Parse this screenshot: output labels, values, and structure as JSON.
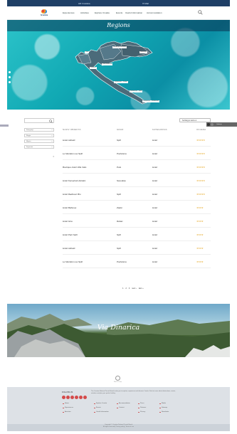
{
  "topbar": {
    "left_text": "HR   hrvatska",
    "right_text": "✉   Mail"
  },
  "logo": {
    "text": "hrvatska"
  },
  "nav": [
    "Experiences",
    "Activities",
    "Explore Croatia",
    "Events",
    "Useful information",
    "Accommodation"
  ],
  "hero": {
    "title": "Regions",
    "map_labels": [
      "Istra",
      "Središnja Hrvatska",
      "Lika-Karlovac",
      "Slavonija",
      "Kvarner",
      "Dalmacija – Zadar",
      "Dalmacija – Split",
      "Dalmacija – Dubrovnik"
    ],
    "colors": {
      "teal": "#11a9b4",
      "land": "#4b6b7a"
    }
  },
  "side_right": {
    "label": "Galerija"
  },
  "filters": {
    "search_placeholder": "",
    "selects": [
      "Kategorija",
      "Regija",
      "Mjesto",
      "Kapacitet"
    ]
  },
  "sort": {
    "label": "Sortiraj po nazivu ▾"
  },
  "table": {
    "headers": [
      "NAZIV OBJEKTA",
      "GRAD",
      "KATEGORIJA",
      "OCJENA"
    ],
    "rows": [
      {
        "name": "Hotel Adriatic",
        "city": "Split",
        "category": "Hotel",
        "stars": "★★★★★"
      },
      {
        "name": "Le Meridien Lav Split",
        "city": "Podstrana",
        "category": "Hotel",
        "stars": "★★★★★"
      },
      {
        "name": "Boutique Hotel Villa Valis",
        "city": "Pula",
        "category": "Hotel",
        "stars": "★★★★★"
      },
      {
        "name": "Hotel Kempinski Adriatic",
        "city": "Savudrija",
        "category": "Hotel",
        "stars": "★★★★★"
      },
      {
        "name": "Hotel Radisson Blu",
        "city": "Split",
        "category": "Hotel",
        "stars": "★★★★★"
      },
      {
        "name": "Hotel Bellevue",
        "city": "Zadar",
        "category": "Hotel",
        "stars": "★★★★"
      },
      {
        "name": "Hotel Istra",
        "city": "Rabac",
        "category": "Hotel",
        "stars": "★★★★"
      },
      {
        "name": "Hotel Park Split",
        "city": "Split",
        "category": "Hotel",
        "stars": "★★★★"
      },
      {
        "name": "Hotel Adriatic",
        "city": "Split",
        "category": "Hotel",
        "stars": "★★★★"
      },
      {
        "name": "Le Meridien Lav Split",
        "city": "Podstrana",
        "category": "Hotel",
        "stars": "★★★★"
      }
    ]
  },
  "pager": {
    "pages": [
      "1",
      "2",
      "3"
    ],
    "next": "next ›",
    "last": "last »"
  },
  "banner": {
    "title": "Via Dinarica"
  },
  "scroll_top": {
    "label": "Back to top"
  },
  "footer": {
    "heading": "FOLLOW US",
    "text": "The Croatian National Tourist Board invites you to explore, experience and discover Croatia. Find out more about destinations, events, activities and plan your perfect holiday.",
    "links": [
      "Home",
      "Experiences",
      "Activities",
      "Explore Croatia",
      "Events",
      "Useful information",
      "Accommodation",
      "Contact",
      "Press",
      "Partners",
      "Media",
      "Sitemap",
      "Newsletter",
      "Privacy"
    ],
    "bottom_lines": [
      "Copyright © Croatian National Tourist Board",
      "All rights reserved | Privacy policy | Terms of use"
    ]
  }
}
